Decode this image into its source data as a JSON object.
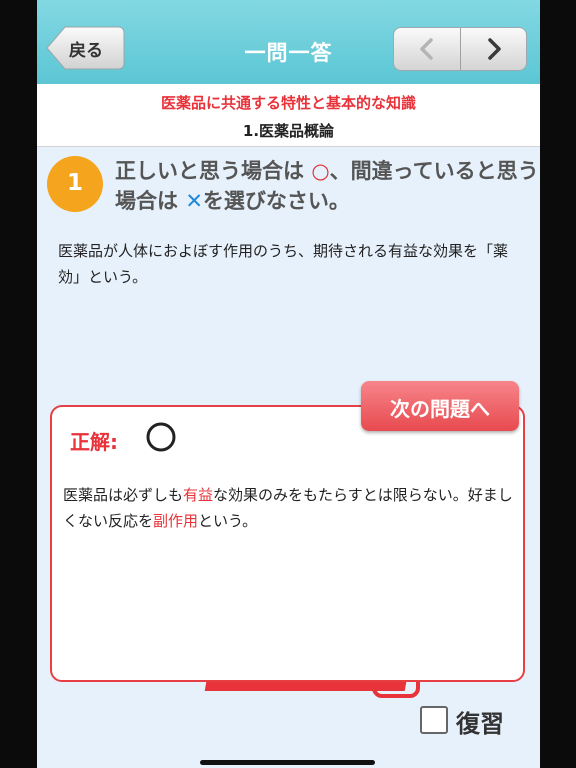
{
  "navbar": {
    "back_label": "戻る",
    "title": "一問一答",
    "prev_icon": "chevron-left-icon",
    "next_icon": "chevron-right-icon"
  },
  "header": {
    "category": "医薬品に共通する特性と基本的な知識",
    "section": "1.医薬品概論"
  },
  "question": {
    "number": "1",
    "instruction_a": "正しいと思う場合は ",
    "instruction_circle": "○",
    "instruction_b": "、間違っていると思う場合は ",
    "instruction_cross": "✕",
    "instruction_c": "を選びなさい。",
    "text": "医薬品が人体におよぼす作用のうち、期待される有益な効果を「薬効」という。"
  },
  "answer": {
    "next_button_label": "次の問題へ",
    "correct_label": "正解:",
    "correct_mark": "circle",
    "explanation_1": "医薬品は必ずしも",
    "explanation_hl1": "有益",
    "explanation_2": "な効果のみをもたらすとは限らない。好ましくない反応を",
    "explanation_hl2": "副作用",
    "explanation_3": "という。"
  },
  "review": {
    "label": "復習",
    "checked": false
  },
  "colors": {
    "accent_red": "#e8333a",
    "navbar": "#5cc6d4",
    "badge": "#f5a51d",
    "cross_blue": "#1f88d8"
  }
}
